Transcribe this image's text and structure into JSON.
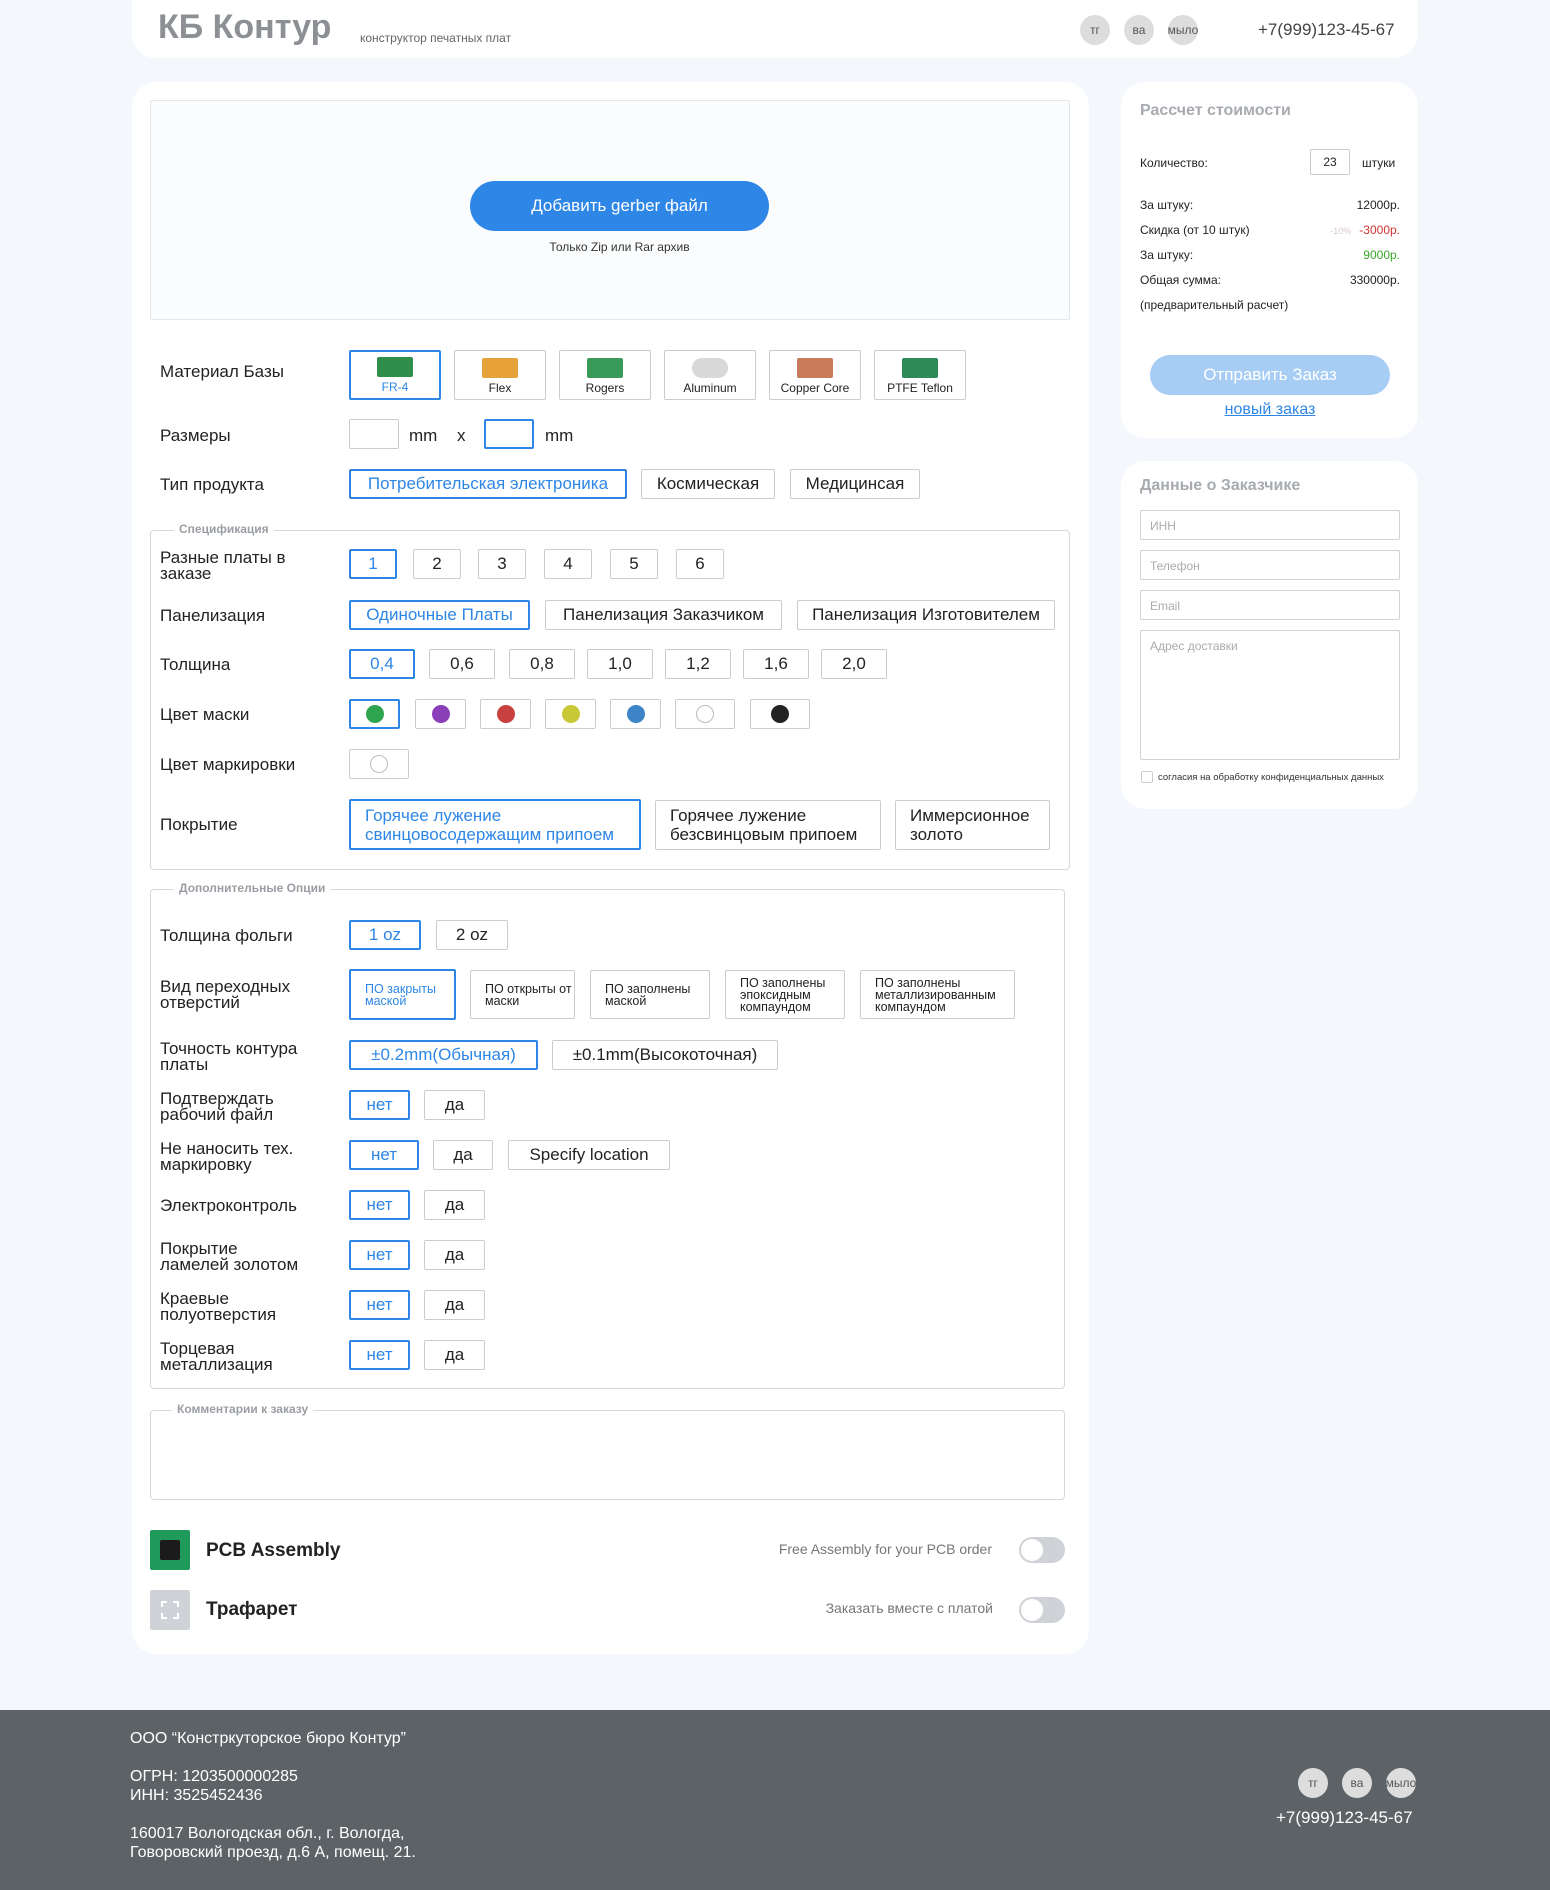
{
  "header": {
    "brand": "КБ Контур",
    "tagline": "конструктор печатных плат",
    "social": [
      "тг",
      "ва",
      "мыло"
    ],
    "phone": "+7(999)123-45-67"
  },
  "upload": {
    "button": "Добавить gerber файл",
    "hint": "Только Zip или Rar архив"
  },
  "material": {
    "label": "Материал Базы",
    "options": [
      "FR-4",
      "Flex",
      "Rogers",
      "Aluminum",
      "Copper Core",
      "PTFE Teflon"
    ],
    "selected": "FR-4"
  },
  "sizes": {
    "label": "Размеры",
    "unit": "mm",
    "sep": "x"
  },
  "product_type": {
    "label": "Тип продукта",
    "options": [
      "Потребительская электроника",
      "Космическая",
      "Медицинсая"
    ],
    "selected": "Потребительская электроника"
  },
  "spec": {
    "legend": "Спецификация",
    "boards": {
      "label": "Разные платы в заказе",
      "options": [
        "1",
        "2",
        "3",
        "4",
        "5",
        "6"
      ],
      "selected": "1"
    },
    "panel": {
      "label": "Панелизация",
      "options": [
        "Одиночные Платы",
        "Панелизация Заказчиком",
        "Панелизация Изготовителем"
      ],
      "selected": "Одиночные Платы"
    },
    "thickness": {
      "label": "Толщина",
      "options": [
        "0,4",
        "0,6",
        "0,8",
        "1,0",
        "1,2",
        "1,6",
        "2,0"
      ],
      "selected": "0,4"
    },
    "mask": {
      "label": "Цвет маски",
      "colors": [
        "#2ea44f",
        "#8a3fb8",
        "#c94040",
        "#c9c938",
        "#3d85c6",
        "#ffffff",
        "#222222"
      ]
    },
    "marking": {
      "label": "Цвет маркировки",
      "colors": [
        "#ffffff"
      ]
    },
    "finish": {
      "label": "Покрытие",
      "options": [
        "Горячее лужение свинцовосодержащим припоем",
        "Горячее лужение безсвинцовым припоем",
        "Иммерсионное золото"
      ],
      "selected": "Горячее лужение свинцовосодержащим припоем"
    }
  },
  "extra": {
    "legend": "Дополнительные Опции",
    "foil": {
      "label": "Толщина фольги",
      "options": [
        "1 oz",
        "2 oz"
      ]
    },
    "vias": {
      "label": "Вид переходных отверстий",
      "options": [
        "ПО закрыты маской",
        "ПО открыты от маски",
        "ПО заполнены маской",
        "ПО заполнены эпоксидным компаундом",
        "ПО заполнены металлизированным компаундом"
      ]
    },
    "contour": {
      "label": "Точность контура платы",
      "options": [
        "±0.2mm(Обычная)",
        "±0.1mm(Высокоточная)"
      ]
    },
    "confirm": {
      "label": "Подтверждать рабочий файл",
      "options": [
        "нет",
        "да"
      ]
    },
    "nomark": {
      "label": "Не наносить тех. маркировку",
      "options": [
        "нет",
        "да",
        "Specify location"
      ]
    },
    "etest": {
      "label": "Электроконтроль",
      "options": [
        "нет",
        "да"
      ]
    },
    "gold": {
      "label": "Покрытие ламелей золотом",
      "options": [
        "нет",
        "да"
      ]
    },
    "castellated": {
      "label": "Краевые полуотверстия",
      "options": [
        "нет",
        "да"
      ]
    },
    "edgeplating": {
      "label": "Торцевая металлизация",
      "options": [
        "нет",
        "да"
      ]
    }
  },
  "comments": {
    "legend": "Комментарии к заказу"
  },
  "assembly": {
    "title": "PCB Assembly",
    "note": "Free Assembly for your PCB order"
  },
  "stencil": {
    "title": "Трафарет",
    "note": "Заказать вместе с платой"
  },
  "calc": {
    "title": "Рассчет стоимости",
    "qty_label": "Количество:",
    "qty": "23",
    "qty_unit": "штуки",
    "per_unit_label": "За штуку:",
    "per_unit": "12000р.",
    "discount_label": "Скидка (от 10 штук)",
    "discount_pct": "-10%",
    "discount": "-3000р.",
    "per_unit2_label": "За штуку:",
    "per_unit2": "9000р.",
    "total_label": "Общая сумма:",
    "total": "330000р.",
    "note": "(предварительный расчет)",
    "submit": "Отправить Заказ",
    "new_order": "новый заказ"
  },
  "customer": {
    "title": "Данные о Заказчике",
    "inn": "ИНН",
    "phone": "Телефон",
    "email": "Email",
    "address": "Адрес доставки",
    "consent": "согласия на обработку конфиденциальных данных"
  },
  "footer": {
    "company": "ООО “Констркуторское бюро Контур”",
    "ogrn": "ОГРН: 1203500000285",
    "inn": "ИНН: 3525452436",
    "addr1": "160017 Вологодская обл., г. Вологда,",
    "addr2": "Говоровский проезд, д.6 А, помещ. 21.",
    "social": [
      "тг",
      "ва",
      "мыло"
    ],
    "phone": "+7(999)123-45-67"
  }
}
